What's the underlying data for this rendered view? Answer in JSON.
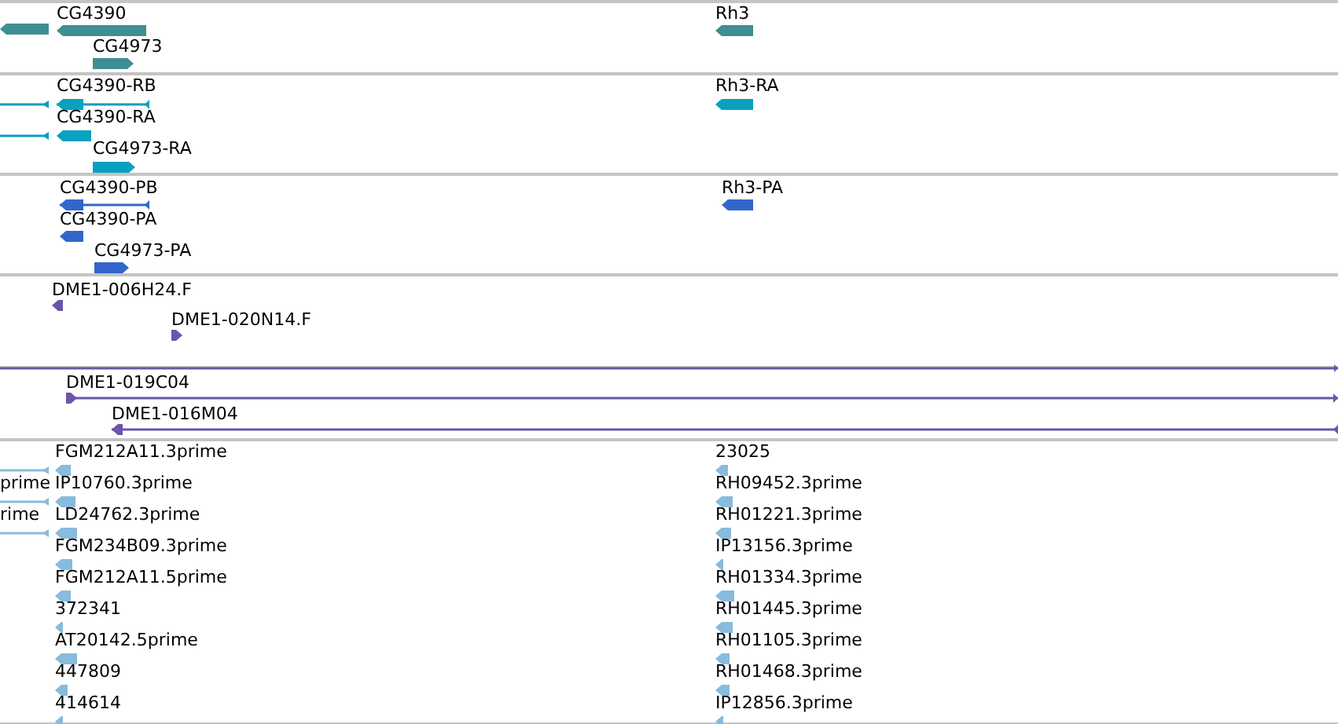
{
  "tracks": [
    {
      "kind": "gene",
      "features": [
        {
          "reverse": true
        },
        {
          "label": "CG4390",
          "reverse": true
        },
        {
          "label": "CG4973",
          "reverse": false
        },
        {
          "label": "Rh3",
          "reverse": true
        }
      ]
    },
    {
      "kind": "transcript",
      "features": [
        {
          "reverse": true
        },
        {
          "label": "CG4390-RB",
          "reverse": true
        },
        {
          "reverse": true
        },
        {
          "label": "CG4390-RA",
          "reverse": true
        },
        {
          "label": "CG4973-RA",
          "reverse": false
        },
        {
          "label": "Rh3-RA",
          "reverse": true
        }
      ]
    },
    {
      "kind": "protein",
      "features": [
        {
          "label": "CG4390-PB",
          "reverse": true
        },
        {
          "label": "CG4390-PA",
          "reverse": true
        },
        {
          "label": "CG4973-PA",
          "reverse": false
        },
        {
          "label": "Rh3-PA",
          "reverse": true
        }
      ]
    },
    {
      "kind": "bac_end",
      "features": [
        {
          "label": "DME1-006H24.F",
          "reverse": true
        },
        {
          "label": "DME1-020N14.F",
          "reverse": false
        }
      ]
    },
    {
      "kind": "bac",
      "features": [
        {
          "reverse": false
        },
        {
          "label": "DME1-019C04",
          "reverse": false
        },
        {
          "label": "DME1-016M04",
          "reverse": true
        }
      ]
    },
    {
      "kind": "est",
      "features": [
        {
          "reverse": true
        },
        {
          "label": "prime",
          "reverse": true
        },
        {
          "label": "rime",
          "reverse": true
        },
        {
          "label": "FGM212A11.3prime",
          "reverse": true
        },
        {
          "label": "IP10760.3prime",
          "reverse": true
        },
        {
          "label": "LD24762.3prime",
          "reverse": true
        },
        {
          "label": "FGM234B09.3prime",
          "reverse": true
        },
        {
          "label": "FGM212A11.5prime",
          "reverse": true
        },
        {
          "label": "372341",
          "reverse": true
        },
        {
          "label": "AT20142.5prime",
          "reverse": true
        },
        {
          "label": "447809",
          "reverse": true
        },
        {
          "label": "414614",
          "reverse": true
        },
        {
          "label": "23025",
          "reverse": true
        },
        {
          "label": "RH09452.3prime",
          "reverse": true
        },
        {
          "label": "RH01221.3prime",
          "reverse": true
        },
        {
          "label": "IP13156.3prime",
          "reverse": true
        },
        {
          "label": "RH01334.3prime",
          "reverse": true
        },
        {
          "label": "RH01445.3prime",
          "reverse": true
        },
        {
          "label": "RH01105.3prime",
          "reverse": true
        },
        {
          "label": "RH01468.3prime",
          "reverse": true
        },
        {
          "label": "IP12856.3prime",
          "reverse": true
        }
      ]
    }
  ]
}
